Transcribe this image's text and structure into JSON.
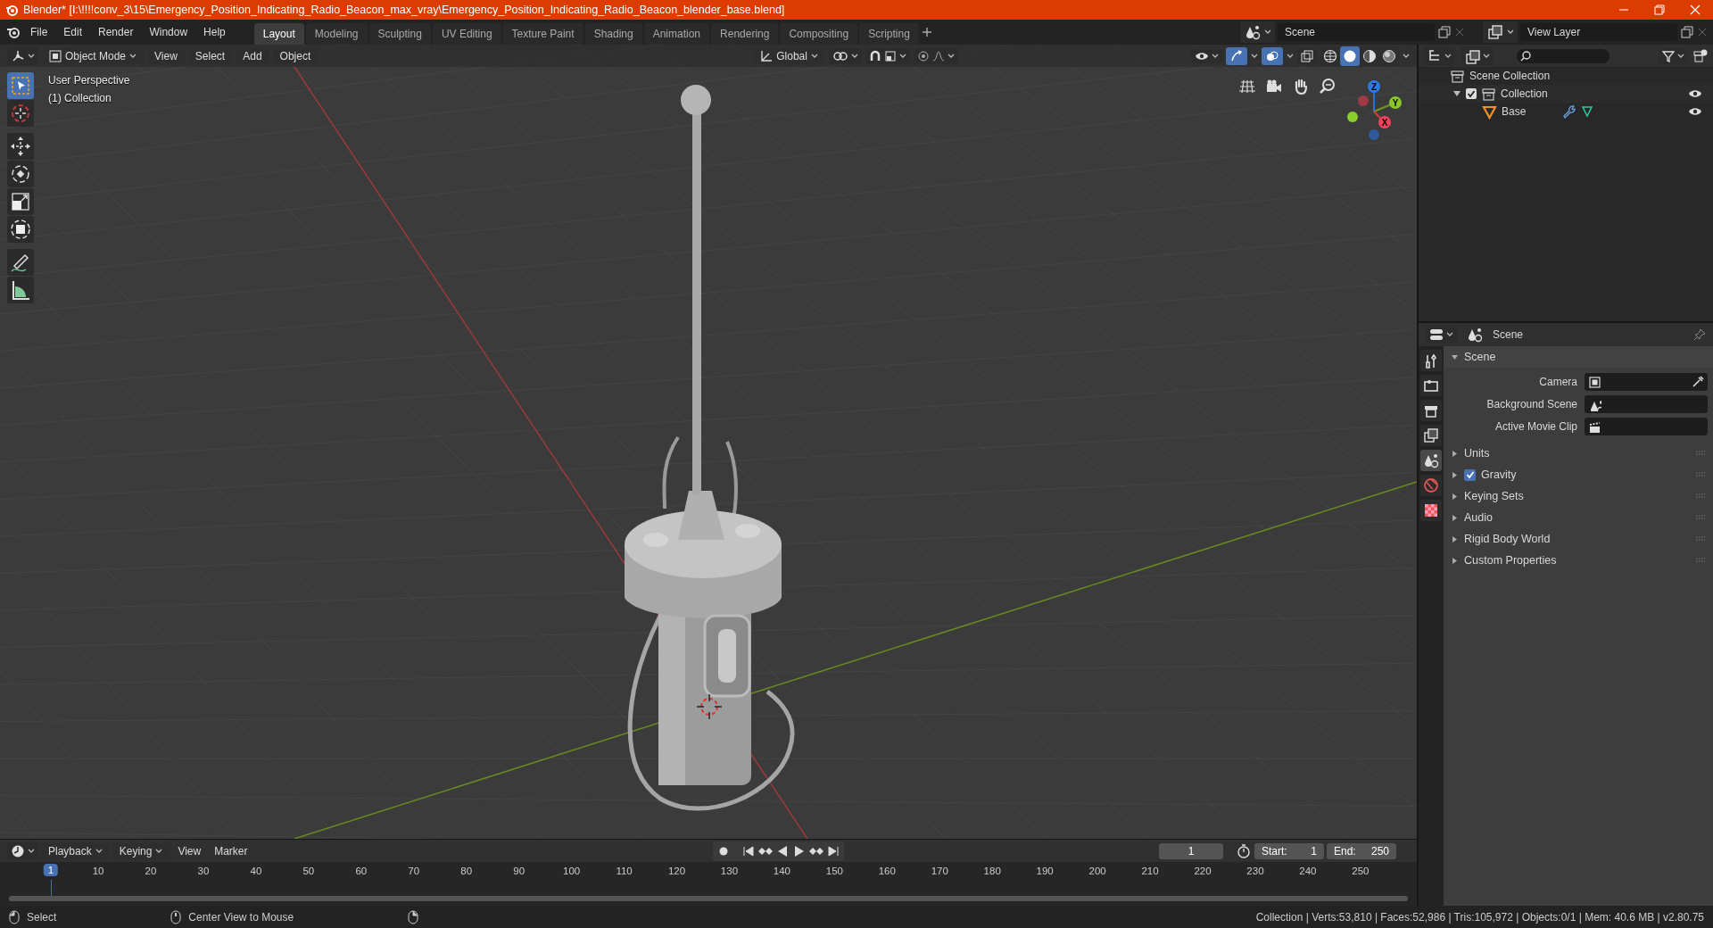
{
  "window": {
    "title": "Blender* [I:\\!!!!conv_3\\15\\Emergency_Position_Indicating_Radio_Beacon_max_vray\\Emergency_Position_Indicating_Radio_Beacon_blender_base.blend]"
  },
  "menu_bar": [
    "File",
    "Edit",
    "Render",
    "Window",
    "Help"
  ],
  "workspaces": [
    {
      "label": "Layout",
      "selected": true
    },
    {
      "label": "Modeling",
      "selected": false
    },
    {
      "label": "Sculpting",
      "selected": false
    },
    {
      "label": "UV Editing",
      "selected": false
    },
    {
      "label": "Texture Paint",
      "selected": false
    },
    {
      "label": "Shading",
      "selected": false
    },
    {
      "label": "Animation",
      "selected": false
    },
    {
      "label": "Rendering",
      "selected": false
    },
    {
      "label": "Compositing",
      "selected": false
    },
    {
      "label": "Scripting",
      "selected": false
    }
  ],
  "scene": "Scene",
  "view_layer": "View Layer",
  "viewport": {
    "mode": "Object Mode",
    "menus": [
      "View",
      "Select",
      "Add",
      "Object"
    ],
    "orientation": "Global",
    "gizmos_on": true,
    "overlays_on": true,
    "shading": [
      {
        "kind": "wireframe",
        "selected": false
      },
      {
        "kind": "solid",
        "selected": true
      },
      {
        "kind": "material",
        "selected": false
      },
      {
        "kind": "rendered",
        "selected": false
      }
    ],
    "perspective": "User Perspective",
    "collection_label": "(1) Collection",
    "tools": [
      {
        "kind": "select",
        "selected": true
      },
      {
        "kind": "cursor",
        "selected": false
      },
      {
        "kind": "move",
        "selected": false
      },
      {
        "kind": "rotate",
        "selected": false
      },
      {
        "kind": "scale",
        "selected": false
      },
      {
        "kind": "transform",
        "selected": false
      },
      {
        "kind": "annotate",
        "selected": false
      },
      {
        "kind": "measure",
        "selected": false
      }
    ],
    "gizmo_axes": [
      "Z",
      "Y",
      "X"
    ]
  },
  "outliner": {
    "tree": [
      {
        "label": "Scene Collection",
        "kind": "scene_collection",
        "children": [
          {
            "label": "Collection",
            "kind": "collection",
            "checked": true,
            "children": [
              {
                "label": "Base",
                "kind": "mesh"
              }
            ]
          }
        ]
      }
    ]
  },
  "properties": {
    "title": "Scene",
    "tabs": [
      {
        "kind": "tool",
        "selected": false
      },
      {
        "kind": "render",
        "selected": false
      },
      {
        "kind": "output",
        "selected": false
      },
      {
        "kind": "view_layer",
        "selected": false
      },
      {
        "kind": "scene",
        "selected": true
      },
      {
        "kind": "world",
        "selected": false
      },
      {
        "kind": "texture",
        "selected": false
      }
    ],
    "panel": {
      "title": "Scene",
      "expanded": true,
      "fields": [
        {
          "label": "Camera",
          "kind": "camera"
        },
        {
          "label": "Background Scene",
          "kind": "scene"
        },
        {
          "label": "Active Movie Clip",
          "kind": "clip"
        }
      ]
    },
    "sections": [
      {
        "label": "Units",
        "kind": "plain"
      },
      {
        "label": "Gravity",
        "kind": "checkbox",
        "checked": true
      },
      {
        "label": "Keying Sets",
        "kind": "plain"
      },
      {
        "label": "Audio",
        "kind": "plain"
      },
      {
        "label": "Rigid Body World",
        "kind": "plain"
      },
      {
        "label": "Custom Properties",
        "kind": "plain"
      }
    ]
  },
  "timeline": {
    "menus": [
      {
        "label": "Playback",
        "kind": "dropdown"
      },
      {
        "label": "Keying",
        "kind": "dropdown"
      },
      {
        "label": "View",
        "kind": "plain"
      },
      {
        "label": "Marker",
        "kind": "plain"
      }
    ],
    "current_frame": "1",
    "start_label": "Start:",
    "start": "1",
    "end_label": "End:",
    "end": "250",
    "playhead": "1",
    "ticks": [
      "10",
      "20",
      "30",
      "40",
      "50",
      "60",
      "70",
      "80",
      "90",
      "100",
      "110",
      "120",
      "130",
      "140",
      "150",
      "160",
      "170",
      "180",
      "190",
      "200",
      "210",
      "220",
      "230",
      "240",
      "250"
    ]
  },
  "status_bar": {
    "hints": [
      "Select",
      "Center View to Mouse"
    ],
    "stats": "Collection | Verts:53,810 | Faces:52,986 | Tris:105,972 | Objects:0/1 | Mem: 40.6 MB | v2.80.75"
  }
}
